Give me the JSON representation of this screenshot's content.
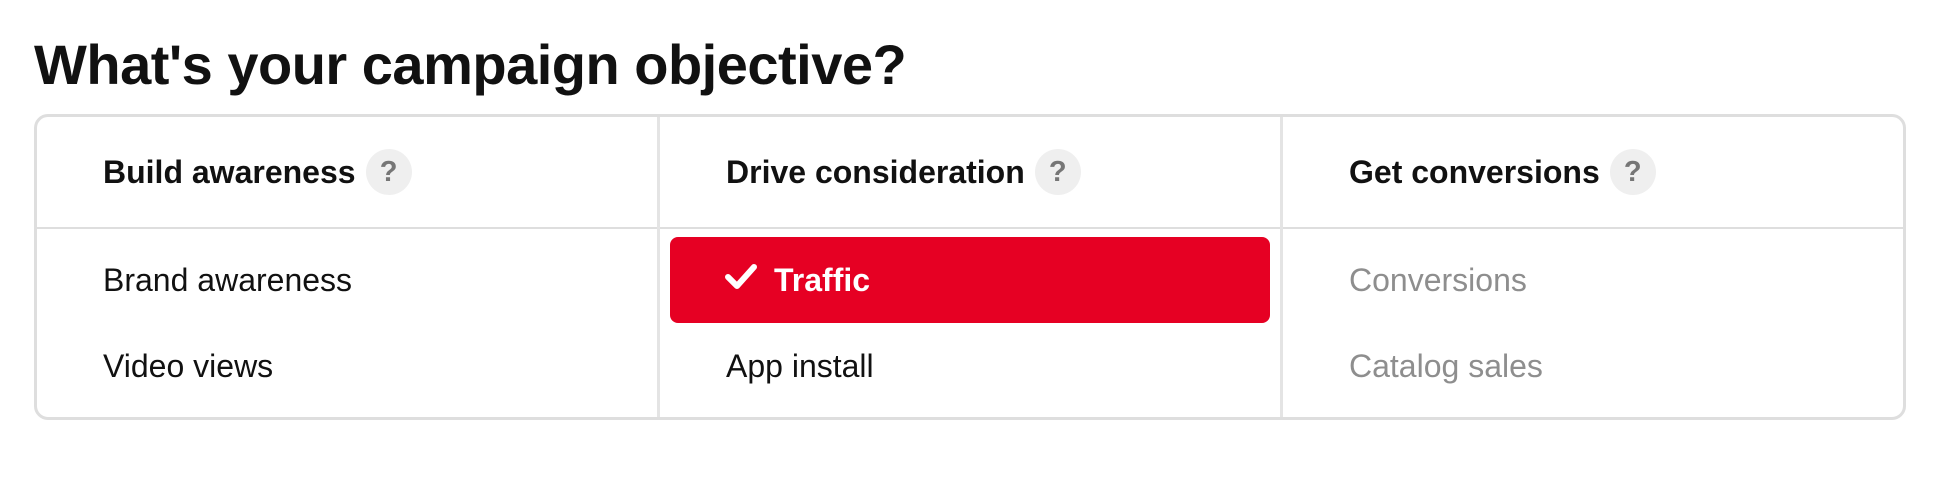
{
  "page": {
    "title": "What's your campaign objective?"
  },
  "columns": [
    {
      "title": "Build awareness",
      "help_icon": "question-mark-icon",
      "help_glyph": "?",
      "options": [
        {
          "label": "Brand awareness",
          "state": "enabled"
        },
        {
          "label": "Video views",
          "state": "enabled"
        }
      ]
    },
    {
      "title": "Drive consideration",
      "help_icon": "question-mark-icon",
      "help_glyph": "?",
      "options": [
        {
          "label": "Traffic",
          "state": "selected"
        },
        {
          "label": "App install",
          "state": "enabled"
        }
      ]
    },
    {
      "title": "Get conversions",
      "help_icon": "question-mark-icon",
      "help_glyph": "?",
      "options": [
        {
          "label": "Conversions",
          "state": "disabled"
        },
        {
          "label": "Catalog sales",
          "state": "disabled"
        }
      ]
    }
  ],
  "colors": {
    "selected_background": "#e60023",
    "disabled_text": "#8e8e8e",
    "border": "#dedede"
  }
}
